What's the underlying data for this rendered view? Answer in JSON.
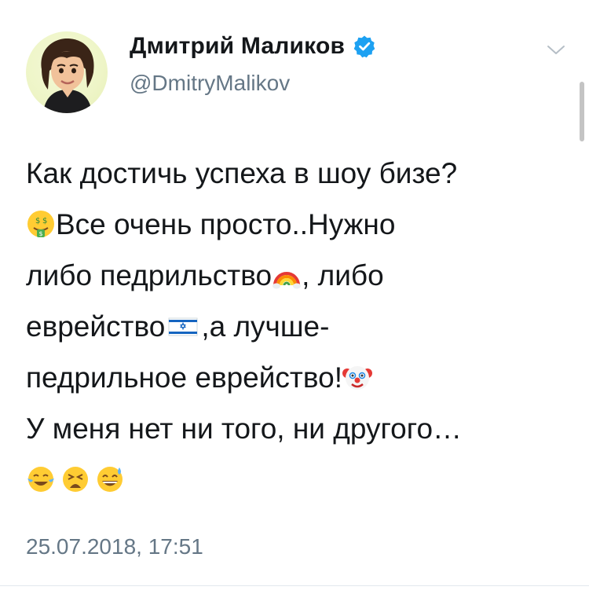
{
  "user": {
    "display_name": "Дмитрий Маликов",
    "handle": "@DmitryMalikov",
    "verified": true,
    "avatar_icon": "memoji-avatar"
  },
  "tweet": {
    "line1": "Как достичь успеха в шоу бизе?",
    "line2_text": "Все очень просто..Нужно",
    "line2_emoji": "money-mouth-face-icon",
    "line3_text_a": "либо педрильство",
    "line3_emoji": "rainbow-icon",
    "line3_text_b": ", либо",
    "line4_text_a": "еврейство",
    "line4_emoji": "israel-flag-icon",
    "line4_text_b": ",а лучше-",
    "line5_text": "педрильное еврейство!",
    "line5_emoji": "clown-face-icon",
    "line6": "У меня нет ни того, ни другого…",
    "line7_emojis": [
      "face-with-tears-of-joy-icon",
      "weary-face-icon",
      "grinning-sweat-icon"
    ]
  },
  "timestamp": "25.07.2018, 17:51",
  "colors": {
    "text": "#14171a",
    "secondary": "#657786",
    "verified": "#1da1f2",
    "divider": "#e1e8ed"
  }
}
